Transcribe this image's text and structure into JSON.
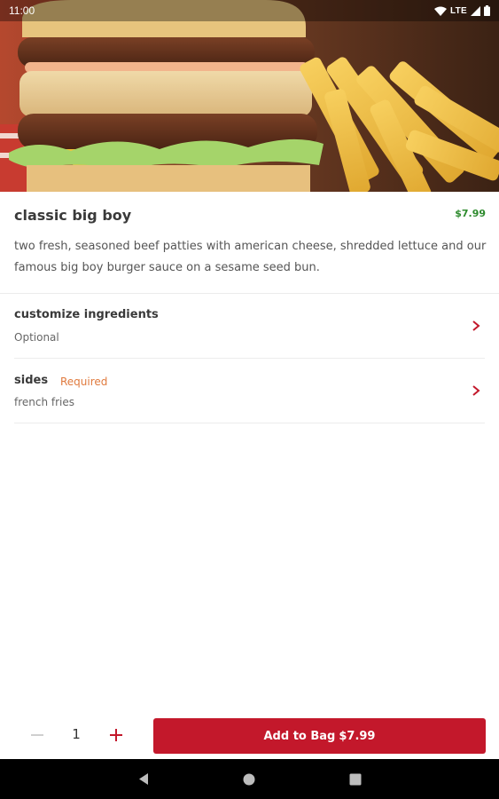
{
  "status_bar": {
    "time": "11:00",
    "network": "LTE",
    "icons": [
      "wifi-icon",
      "signal-icon",
      "battery-icon"
    ]
  },
  "hero": {
    "image": "burger-and-fries-photo"
  },
  "item": {
    "title": "classic big boy",
    "price": "$7.99",
    "description": "two fresh, seasoned beef patties with american cheese, shredded lettuce and our famous big boy burger sauce on a sesame seed bun."
  },
  "options": [
    {
      "title": "customize ingredients",
      "badge": "",
      "subtitle": "Optional"
    },
    {
      "title": "sides",
      "badge": "Required",
      "subtitle": "french fries"
    }
  ],
  "quantity": {
    "value": "1"
  },
  "add_button": {
    "label": "Add to Bag",
    "price": "$7.99"
  },
  "colors": {
    "brand_red": "#c3182b",
    "price_green": "#2e8b2e",
    "required_orange": "#e07a3e"
  }
}
